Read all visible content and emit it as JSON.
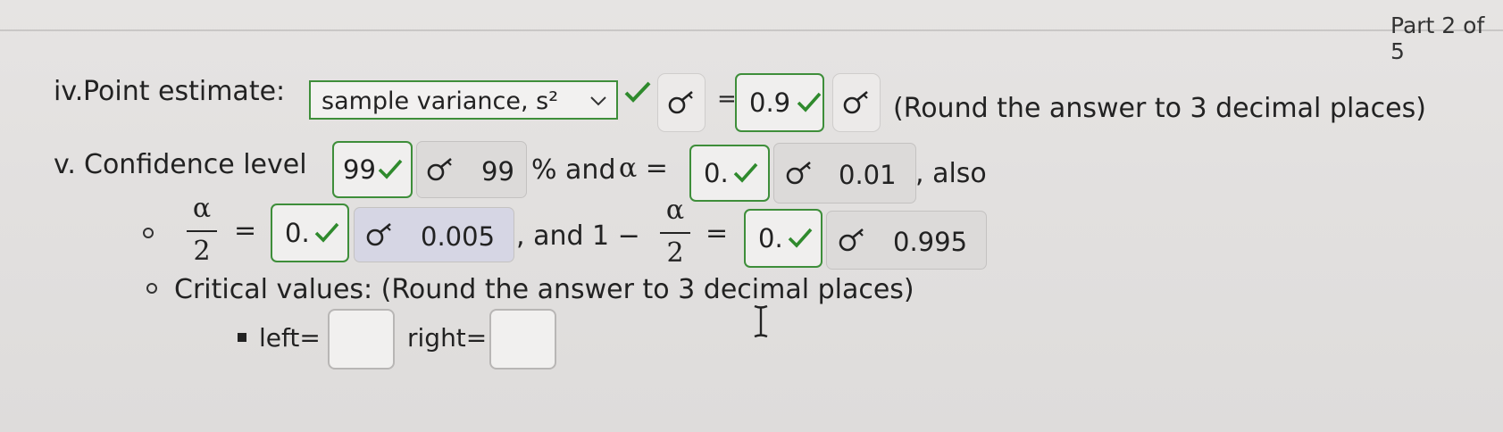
{
  "header": {
    "part_label": "Part 2 of 5"
  },
  "row_iv": {
    "marker": "iv.",
    "label": "Point estimate:",
    "dropdown_value": "sample variance, s²",
    "equals": "=",
    "answer_value": "0.9",
    "instruction": "(Round the answer to 3 decimal places)"
  },
  "row_v": {
    "marker": "v.",
    "label": "Confidence level",
    "confidence_input": "99",
    "confidence_revealed": "99",
    "percent_and": "% and",
    "alpha_eq": "α =",
    "alpha_input": "0.",
    "alpha_revealed": "0.01",
    "also": ", also"
  },
  "row_half": {
    "alpha_sym": "α",
    "two": "2",
    "equals": "=",
    "half_input": "0.",
    "half_revealed": "0.005",
    "and_one_minus": ", and 1 −",
    "one_minus_input": "0.",
    "one_minus_revealed": "0.995"
  },
  "row_critical": {
    "label": "Critical values: (Round the answer to 3 decimal places)"
  },
  "row_lr": {
    "left_label": "left=",
    "right_label": "right=",
    "left_value": "",
    "right_value": ""
  },
  "colors": {
    "correct": "#2f8a2d",
    "box_border": "#3e8e3a",
    "revealed_bg": "#dcdad9"
  }
}
